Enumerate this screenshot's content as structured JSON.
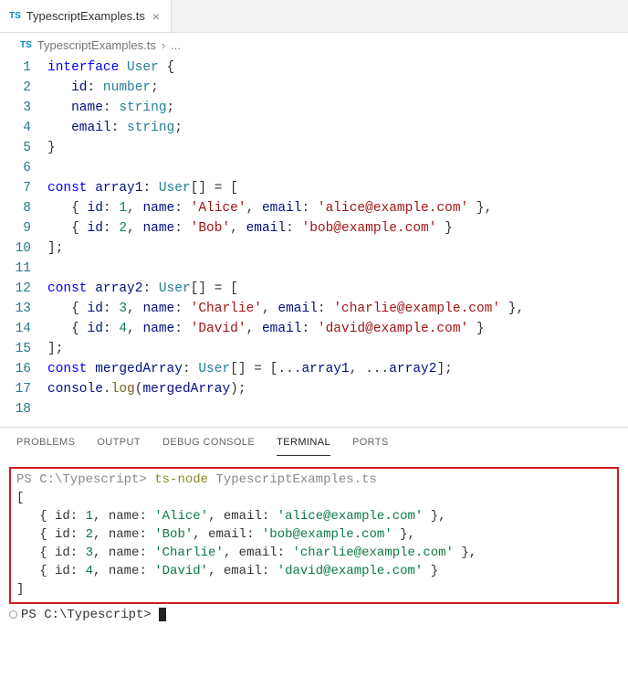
{
  "tab": {
    "icon": "TS",
    "label": "TypescriptExamples.ts",
    "close": "×"
  },
  "breadcrumb": {
    "icon": "TS",
    "file": "TypescriptExamples.ts",
    "sep": "›",
    "more": "..."
  },
  "code": {
    "lines": [
      {
        "n": "1",
        "tokens": [
          [
            "kw",
            "interface"
          ],
          [
            "",
            ""
          ],
          [
            "type",
            " User"
          ],
          [
            "punct",
            " {"
          ]
        ]
      },
      {
        "n": "2",
        "tokens": [
          [
            "",
            "   "
          ],
          [
            "ident",
            "id"
          ],
          [
            "punct",
            ": "
          ],
          [
            "type",
            "number"
          ],
          [
            "punct",
            ";"
          ]
        ]
      },
      {
        "n": "3",
        "tokens": [
          [
            "",
            "   "
          ],
          [
            "ident",
            "name"
          ],
          [
            "punct",
            ": "
          ],
          [
            "type",
            "string"
          ],
          [
            "punct",
            ";"
          ]
        ]
      },
      {
        "n": "4",
        "tokens": [
          [
            "",
            "   "
          ],
          [
            "ident",
            "email"
          ],
          [
            "punct",
            ": "
          ],
          [
            "type",
            "string"
          ],
          [
            "punct",
            ";"
          ]
        ]
      },
      {
        "n": "5",
        "tokens": [
          [
            "punct",
            "}"
          ]
        ]
      },
      {
        "n": "6",
        "tokens": [
          [
            "",
            ""
          ]
        ]
      },
      {
        "n": "7",
        "tokens": [
          [
            "kw",
            "const"
          ],
          [
            "",
            " "
          ],
          [
            "ident",
            "array1"
          ],
          [
            "punct",
            ": "
          ],
          [
            "type",
            "User"
          ],
          [
            "punct",
            "[] = ["
          ]
        ]
      },
      {
        "n": "8",
        "tokens": [
          [
            "",
            "   "
          ],
          [
            "punct",
            "{ "
          ],
          [
            "ident",
            "id"
          ],
          [
            "punct",
            ": "
          ],
          [
            "num",
            "1"
          ],
          [
            "punct",
            ", "
          ],
          [
            "ident",
            "name"
          ],
          [
            "punct",
            ": "
          ],
          [
            "str",
            "'Alice'"
          ],
          [
            "punct",
            ", "
          ],
          [
            "ident",
            "email"
          ],
          [
            "punct",
            ": "
          ],
          [
            "str",
            "'alice@example.com'"
          ],
          [
            "punct",
            " },"
          ]
        ]
      },
      {
        "n": "9",
        "tokens": [
          [
            "",
            "   "
          ],
          [
            "punct",
            "{ "
          ],
          [
            "ident",
            "id"
          ],
          [
            "punct",
            ": "
          ],
          [
            "num",
            "2"
          ],
          [
            "punct",
            ", "
          ],
          [
            "ident",
            "name"
          ],
          [
            "punct",
            ": "
          ],
          [
            "str",
            "'Bob'"
          ],
          [
            "punct",
            ", "
          ],
          [
            "ident",
            "email"
          ],
          [
            "punct",
            ": "
          ],
          [
            "str",
            "'bob@example.com'"
          ],
          [
            "punct",
            " }"
          ]
        ]
      },
      {
        "n": "10",
        "tokens": [
          [
            "punct",
            "];"
          ]
        ]
      },
      {
        "n": "11",
        "tokens": [
          [
            "",
            ""
          ]
        ]
      },
      {
        "n": "12",
        "tokens": [
          [
            "kw",
            "const"
          ],
          [
            "",
            " "
          ],
          [
            "ident",
            "array2"
          ],
          [
            "punct",
            ": "
          ],
          [
            "type",
            "User"
          ],
          [
            "punct",
            "[] = ["
          ]
        ]
      },
      {
        "n": "13",
        "tokens": [
          [
            "",
            "   "
          ],
          [
            "punct",
            "{ "
          ],
          [
            "ident",
            "id"
          ],
          [
            "punct",
            ": "
          ],
          [
            "num",
            "3"
          ],
          [
            "punct",
            ", "
          ],
          [
            "ident",
            "name"
          ],
          [
            "punct",
            ": "
          ],
          [
            "str",
            "'Charlie'"
          ],
          [
            "punct",
            ", "
          ],
          [
            "ident",
            "email"
          ],
          [
            "punct",
            ": "
          ],
          [
            "str",
            "'charlie@example.com'"
          ],
          [
            "punct",
            " },"
          ]
        ]
      },
      {
        "n": "14",
        "tokens": [
          [
            "",
            "   "
          ],
          [
            "punct",
            "{ "
          ],
          [
            "ident",
            "id"
          ],
          [
            "punct",
            ": "
          ],
          [
            "num",
            "4"
          ],
          [
            "punct",
            ", "
          ],
          [
            "ident",
            "name"
          ],
          [
            "punct",
            ": "
          ],
          [
            "str",
            "'David'"
          ],
          [
            "punct",
            ", "
          ],
          [
            "ident",
            "email"
          ],
          [
            "punct",
            ": "
          ],
          [
            "str",
            "'david@example.com'"
          ],
          [
            "punct",
            " }"
          ]
        ]
      },
      {
        "n": "15",
        "tokens": [
          [
            "punct",
            "];"
          ]
        ]
      },
      {
        "n": "16",
        "tokens": [
          [
            "kw",
            "const"
          ],
          [
            "",
            " "
          ],
          [
            "ident",
            "mergedArray"
          ],
          [
            "punct",
            ": "
          ],
          [
            "type",
            "User"
          ],
          [
            "punct",
            "[] = [..."
          ],
          [
            "ident",
            "array1"
          ],
          [
            "punct",
            ", ..."
          ],
          [
            "ident",
            "array2"
          ],
          [
            "punct",
            "];"
          ]
        ]
      },
      {
        "n": "17",
        "tokens": [
          [
            "ident",
            "console"
          ],
          [
            "punct",
            "."
          ],
          [
            "fn",
            "log"
          ],
          [
            "punct",
            "("
          ],
          [
            "ident",
            "mergedArray"
          ],
          [
            "punct",
            ");"
          ]
        ]
      },
      {
        "n": "18",
        "tokens": [
          [
            "",
            ""
          ]
        ]
      }
    ]
  },
  "panels": {
    "problems": "PROBLEMS",
    "output": "OUTPUT",
    "debug": "DEBUG CONSOLE",
    "terminal": "TERMINAL",
    "ports": "PORTS"
  },
  "terminal": {
    "cmd_prompt": "PS C:\\Typescript>",
    "cmd_tool": "ts-node",
    "cmd_arg": "TypescriptExamples.ts",
    "open": "[",
    "rows": [
      {
        "id": "1",
        "name": "'Alice'",
        "email": "'alice@example.com'"
      },
      {
        "id": "2",
        "name": "'Bob'",
        "email": "'bob@example.com'"
      },
      {
        "id": "3",
        "name": "'Charlie'",
        "email": "'charlie@example.com'"
      },
      {
        "id": "4",
        "name": "'David'",
        "email": "'david@example.com'"
      }
    ],
    "close": "]",
    "prompt2": "PS C:\\Typescript>"
  }
}
